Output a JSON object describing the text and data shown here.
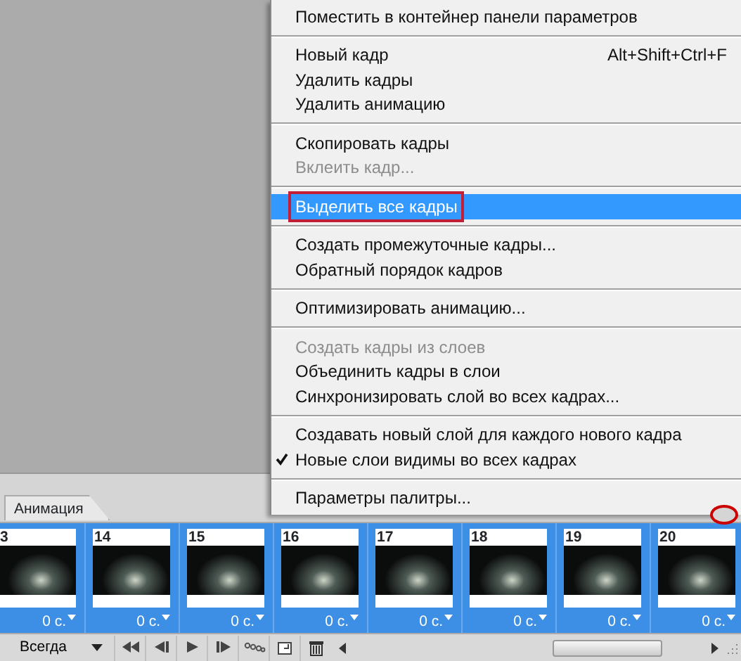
{
  "menu": {
    "groups": [
      [
        {
          "label": "Поместить в контейнер панели параметров",
          "disabled": false,
          "checked": false,
          "selected": false,
          "outlined": false
        }
      ],
      [
        {
          "label": "Новый кадр",
          "shortcut": "Alt+Shift+Ctrl+F",
          "disabled": false,
          "checked": false,
          "selected": false,
          "outlined": false
        },
        {
          "label": "Удалить кадры",
          "disabled": false,
          "checked": false,
          "selected": false,
          "outlined": false
        },
        {
          "label": "Удалить анимацию",
          "disabled": false,
          "checked": false,
          "selected": false,
          "outlined": false
        }
      ],
      [
        {
          "label": "Скопировать кадры",
          "disabled": false,
          "checked": false,
          "selected": false,
          "outlined": false
        },
        {
          "label": "Вклеить кадр...",
          "disabled": true,
          "checked": false,
          "selected": false,
          "outlined": false
        }
      ],
      [
        {
          "label": "Выделить все кадры",
          "disabled": false,
          "checked": false,
          "selected": true,
          "outlined": true
        }
      ],
      [
        {
          "label": "Создать промежуточные кадры...",
          "disabled": false,
          "checked": false,
          "selected": false,
          "outlined": false
        },
        {
          "label": "Обратный порядок кадров",
          "disabled": false,
          "checked": false,
          "selected": false,
          "outlined": false
        }
      ],
      [
        {
          "label": "Оптимизировать анимацию...",
          "disabled": false,
          "checked": false,
          "selected": false,
          "outlined": false
        }
      ],
      [
        {
          "label": "Создать кадры из слоев",
          "disabled": true,
          "checked": false,
          "selected": false,
          "outlined": false
        },
        {
          "label": "Объединить кадры в слои",
          "disabled": false,
          "checked": false,
          "selected": false,
          "outlined": false
        },
        {
          "label": "Синхронизировать слой во всех кадрах...",
          "disabled": false,
          "checked": false,
          "selected": false,
          "outlined": false
        }
      ],
      [
        {
          "label": "Создавать новый слой для каждого нового кадра",
          "disabled": false,
          "checked": false,
          "selected": false,
          "outlined": false
        },
        {
          "label": "Новые слои видимы во всех кадрах",
          "disabled": false,
          "checked": true,
          "selected": false,
          "outlined": false
        }
      ],
      [
        {
          "label": "Параметры палитры...",
          "disabled": false,
          "checked": false,
          "selected": false,
          "outlined": false
        }
      ]
    ]
  },
  "panel": {
    "tab": "Анимация",
    "menu_button_outlined": true,
    "frames": [
      {
        "number": "3",
        "delay": "0 с.",
        "selected": true
      },
      {
        "number": "14",
        "delay": "0 с.",
        "selected": true
      },
      {
        "number": "15",
        "delay": "0 с.",
        "selected": true
      },
      {
        "number": "16",
        "delay": "0 с.",
        "selected": true
      },
      {
        "number": "17",
        "delay": "0 с.",
        "selected": true
      },
      {
        "number": "18",
        "delay": "0 с.",
        "selected": true
      },
      {
        "number": "19",
        "delay": "0 с.",
        "selected": true
      },
      {
        "number": "20",
        "delay": "0 с.",
        "selected": true
      }
    ],
    "loop": "Всегда"
  }
}
